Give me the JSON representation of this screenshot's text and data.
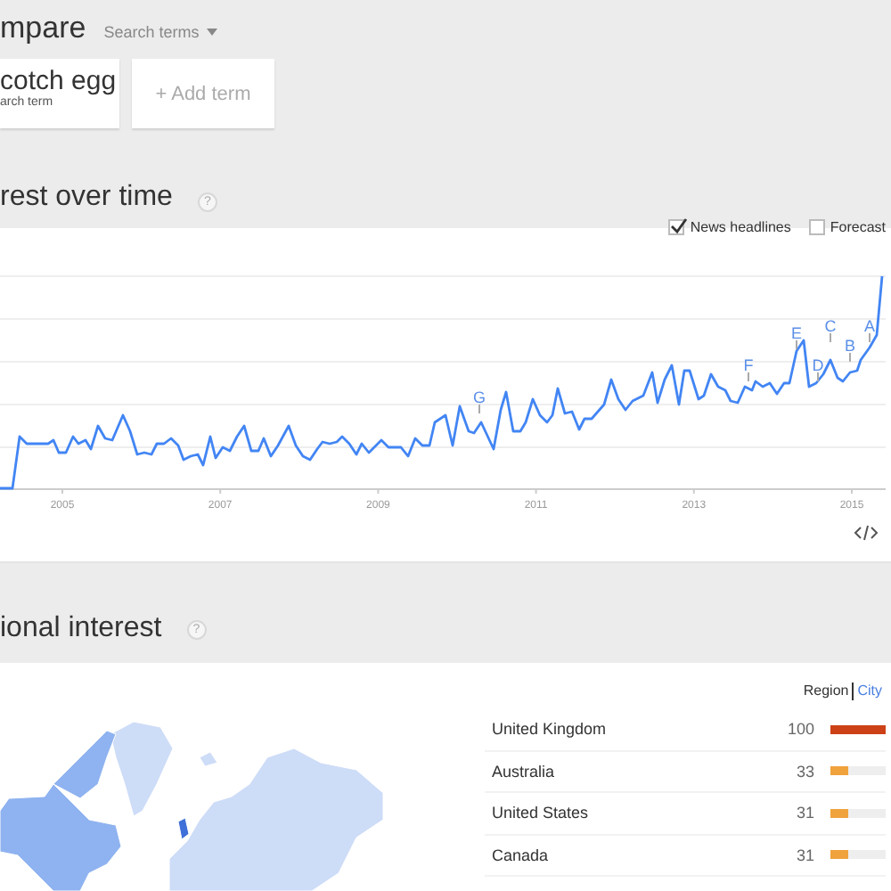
{
  "compare": {
    "title": "mpare",
    "search_terms": "Search terms",
    "terms": [
      {
        "name": "cotch egg",
        "subtitle": "arch term"
      }
    ],
    "add_term": "+ Add term"
  },
  "interest_over_time": {
    "title": "rest over time",
    "help": "?",
    "options": [
      {
        "label": "News headlines",
        "checked": true
      },
      {
        "label": "Forecast",
        "checked": false
      }
    ],
    "x_labels": [
      "2005",
      "2007",
      "2009",
      "2011",
      "2013",
      "2015"
    ],
    "annotations": [
      "G",
      "F",
      "E",
      "D",
      "C",
      "B",
      "A"
    ]
  },
  "regional_interest": {
    "title": "ional interest",
    "help": "?",
    "views": [
      {
        "label": "Region",
        "selected": true
      },
      {
        "label": "City",
        "selected": false
      }
    ],
    "rows": [
      {
        "name": "United Kingdom",
        "value": "100",
        "level": 1.0,
        "color": "#cc4116"
      },
      {
        "name": "Australia",
        "value": "33",
        "level": 0.33,
        "color": "#f0a23c"
      },
      {
        "name": "United States",
        "value": "31",
        "level": 0.31,
        "color": "#f0a23c"
      },
      {
        "name": "Canada",
        "value": "31",
        "level": 0.31,
        "color": "#f0a23c"
      }
    ]
  }
}
